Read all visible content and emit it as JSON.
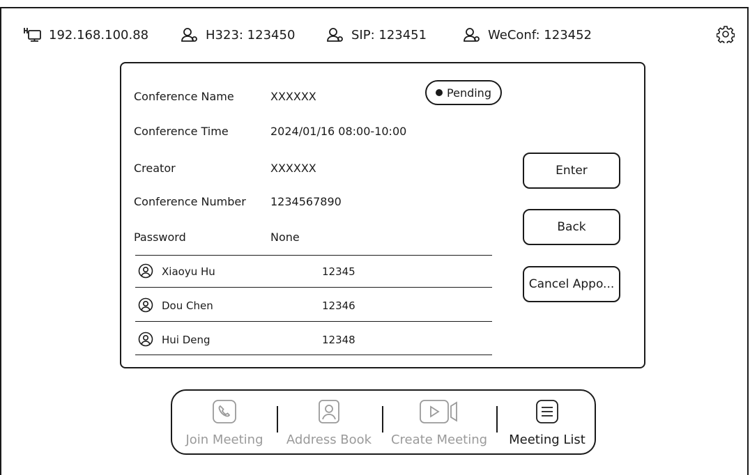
{
  "status": {
    "ip": "192.168.100.88",
    "h323": "H323: 123450",
    "sip": "SIP: 123451",
    "weconf": "WeConf: 123452"
  },
  "conference": {
    "status_badge": "Pending",
    "fields": [
      {
        "label": "Conference Name",
        "value": "XXXXXX"
      },
      {
        "label": "Conference Time",
        "value": "2024/01/16 08:00-10:00"
      },
      {
        "label": "Creator",
        "value": "XXXXXX"
      },
      {
        "label": "Conference Number",
        "value": "1234567890"
      },
      {
        "label": "Password",
        "value": "None"
      }
    ],
    "participants": [
      {
        "name": "Xiaoyu Hu",
        "number": "12345"
      },
      {
        "name": "Dou Chen",
        "number": "12346"
      },
      {
        "name": "Hui Deng",
        "number": "12348"
      }
    ]
  },
  "actions": {
    "enter": "Enter",
    "back": "Back",
    "cancel": "Cancel Appo..."
  },
  "nav": [
    {
      "label": "Join Meeting",
      "icon": "phone-icon",
      "active": false
    },
    {
      "label": "Address Book",
      "icon": "contact-icon",
      "active": false
    },
    {
      "label": "Create Meeting",
      "icon": "video-icon",
      "active": false
    },
    {
      "label": "Meeting List",
      "icon": "list-icon",
      "active": true
    }
  ]
}
